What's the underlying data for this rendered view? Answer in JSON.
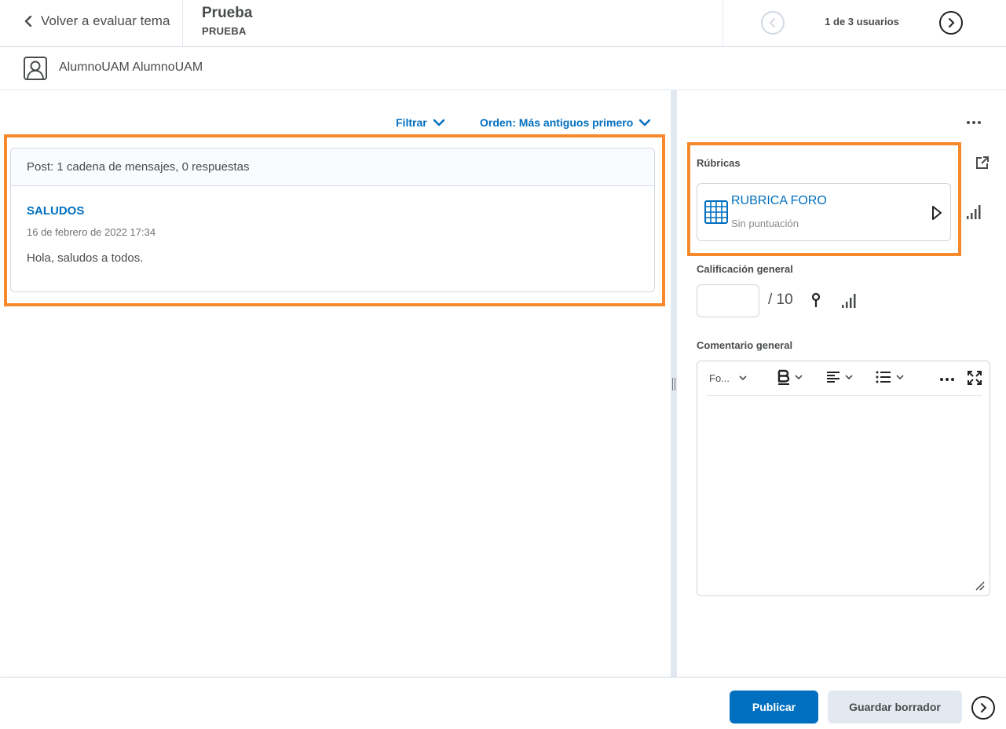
{
  "header": {
    "back_label": "Volver a evaluar tema",
    "title": "Prueba",
    "subtitle": "PRUEBA",
    "user_count": "1 de 3 usuarios"
  },
  "user": {
    "name": "AlumnoUAM AlumnoUAM"
  },
  "discussion": {
    "filter_label": "Filtrar",
    "order_label": "Orden: Más antiguos primero",
    "summary": "Post: 1 cadena de mensajes, 0 respuestas",
    "post": {
      "title": "SALUDOS",
      "date": "16 de febrero de 2022 17:34",
      "body": "Hola, saludos a todos."
    }
  },
  "evaluation": {
    "rubrics_label": "Rúbricas",
    "rubric_name": "RUBRICA FORO",
    "rubric_status": "Sin puntuación",
    "overall_grade_label": "Calificación general",
    "grade_value": "",
    "grade_max": "/ 10",
    "comment_label": "Comentario general",
    "toolbar": {
      "font_label": "Fo..."
    }
  },
  "footer": {
    "publish_label": "Publicar",
    "save_draft_label": "Guardar borrador"
  },
  "colors": {
    "accent": "#006fbf",
    "highlight": "#f6892c",
    "text": "#494c4e"
  },
  "icons": [
    "chevron-left-icon",
    "circle-arrow-left-icon",
    "circle-arrow-right-icon",
    "user-avatar-icon",
    "chevron-down-icon",
    "more-icon",
    "popout-icon",
    "stats-icon",
    "rubric-grid-icon",
    "play-icon",
    "pin-icon",
    "bold-icon",
    "align-icon",
    "list-icon",
    "fullscreen-icon",
    "resize-icon"
  ]
}
